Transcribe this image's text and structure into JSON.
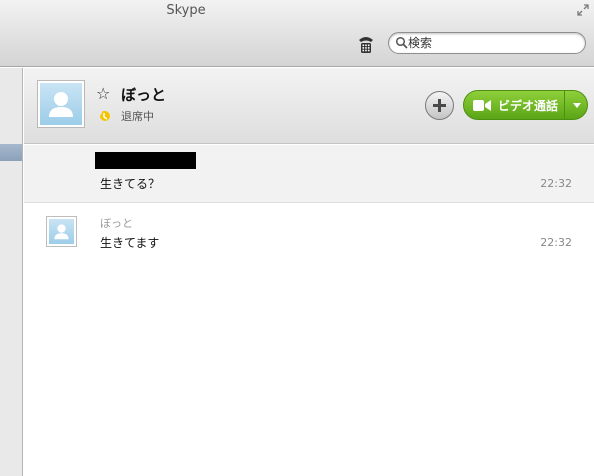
{
  "window": {
    "title": "Skype"
  },
  "toolbar": {
    "search_placeholder": "検索"
  },
  "contact": {
    "name": "ぼっと",
    "status": "退席中"
  },
  "actions": {
    "video_call_label": "ビデオ通話"
  },
  "messages": [
    {
      "sender": "",
      "text": "生きてる？",
      "time": "22:32"
    },
    {
      "sender": "ぼっと",
      "text": "生きてます",
      "time": "22:32"
    }
  ],
  "colors": {
    "accent_green": "#6ab822",
    "away_status": "#f5c400",
    "sidebar_selection": "#95a9c0"
  },
  "icons": [
    "fullscreen-icon",
    "dialpad-icon",
    "search-icon",
    "star-icon",
    "away-status-icon",
    "plus-icon",
    "video-camera-icon",
    "chevron-down-icon",
    "default-avatar-icon"
  ]
}
